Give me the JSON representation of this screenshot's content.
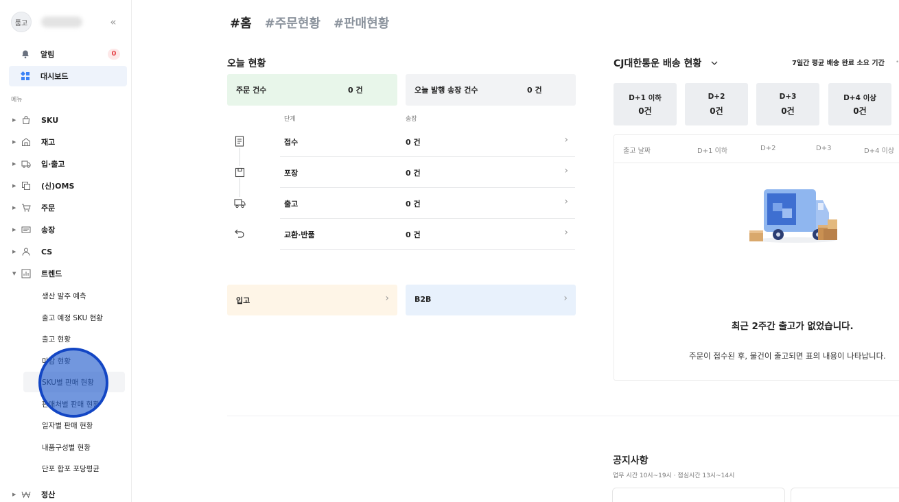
{
  "sidebar": {
    "avatar_text": "품고",
    "top_items": [
      {
        "label": "알림",
        "badge": "0"
      },
      {
        "label": "대시보드"
      }
    ],
    "menu_caption": "메뉴",
    "nav": [
      {
        "label": "SKU"
      },
      {
        "label": "재고"
      },
      {
        "label": "입·출고"
      },
      {
        "label": "(신)OMS"
      },
      {
        "label": "주문"
      },
      {
        "label": "송장"
      },
      {
        "label": "CS"
      },
      {
        "label": "트렌드"
      },
      {
        "label": "정산"
      }
    ],
    "trend_sub": [
      "생산 발주 예측",
      "출고 예정 SKU 현황",
      "출고 현황",
      "마감 현황",
      "SKU별 판매 현황",
      "판매처별 판매 현황",
      "일자별 판매 현황",
      "내품구성별 현황",
      "단포 합포 포당평균"
    ]
  },
  "tabs": [
    "#홈",
    "#주문현황",
    "#판매현황"
  ],
  "today": {
    "title": "오늘 현황",
    "order_count_label": "주문 건수",
    "order_count_value": "0 건",
    "invoice_label": "오늘 발행 송장 건수",
    "invoice_value": "0 건",
    "col_stage": "단계",
    "col_invoice": "송장",
    "stages": [
      {
        "name": "접수",
        "value": "0 건"
      },
      {
        "name": "포장",
        "value": "0 건"
      },
      {
        "name": "출고",
        "value": "0 건"
      },
      {
        "name": "교환·반품",
        "value": "0 건"
      }
    ],
    "inbound_label": "입고",
    "b2b_label": "B2B",
    "colors": {
      "order_bg": "#e8f6ea",
      "gray_bg": "#f2f3f5",
      "inbound_bg": "#fef5e7",
      "b2b_bg": "#e8f1fc"
    }
  },
  "delivery": {
    "title": "CJ대한통운 배송 현황",
    "avg_label": "7일간 평균 배송 완료 소요 기간",
    "boxes": [
      {
        "label": "D+1 이하",
        "value": "0건"
      },
      {
        "label": "D+2",
        "value": "0건"
      },
      {
        "label": "D+3",
        "value": "0건"
      },
      {
        "label": "D+4 이상",
        "value": "0건"
      }
    ],
    "table_headers": [
      "출고 날짜",
      "D+1 이하",
      "D+2",
      "D+3",
      "D+4 이상"
    ],
    "empty_title": "최근 2주간 출고가 없었습니다.",
    "empty_desc": "주문이 접수된 후, 물건이 출고되면 표의 내용이 나타납니다."
  },
  "notice": {
    "title": "공지사항",
    "hours": "업무 시간 10시~19시 · 점심시간 13시~14시"
  }
}
